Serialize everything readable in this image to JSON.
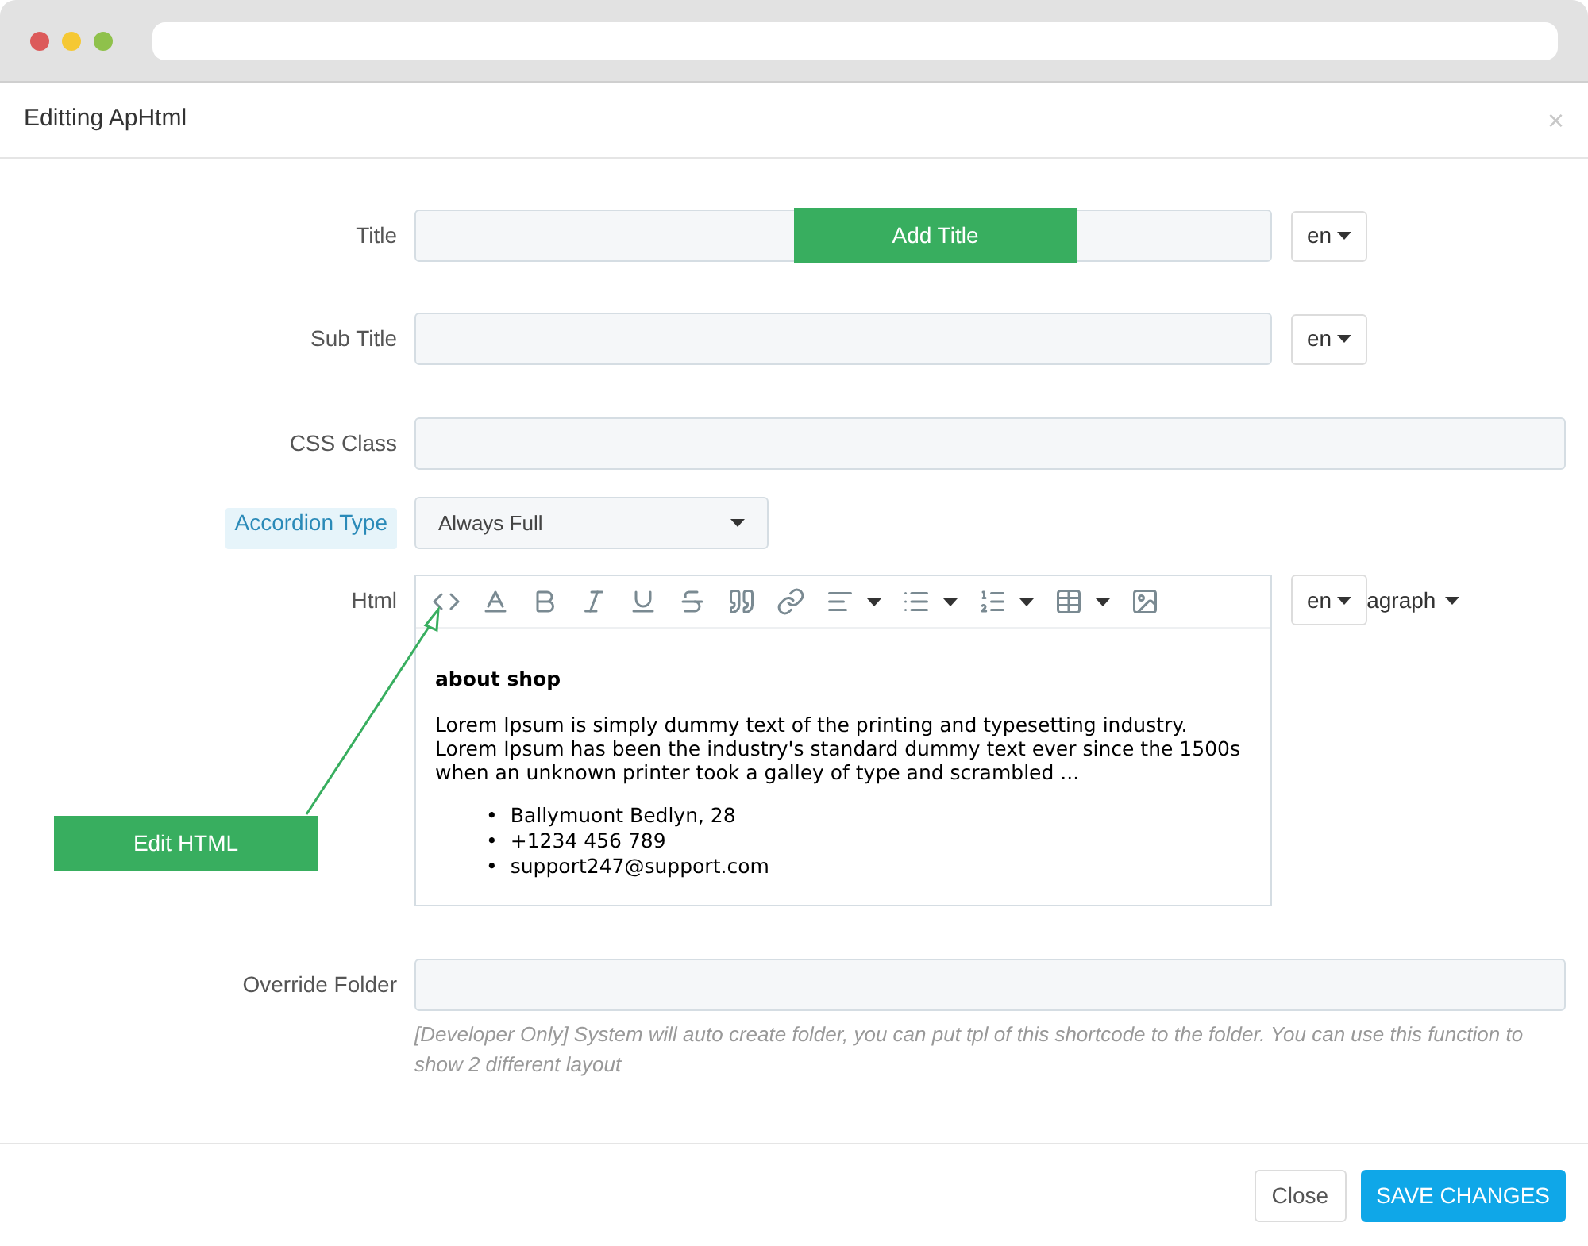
{
  "modal": {
    "title": "Editting ApHtml",
    "close": "×"
  },
  "fields": [
    {
      "kind": "text",
      "label": "Title",
      "lang": "en"
    },
    {
      "kind": "text",
      "label": "Sub Title",
      "lang": "en"
    },
    {
      "kind": "text",
      "label": "CSS Class"
    },
    {
      "kind": "select",
      "label": "Accordion Type",
      "highlighted": true,
      "value": "Always Full"
    },
    {
      "kind": "editor",
      "label": "Html",
      "lang": "en",
      "overflow_text": "agraph",
      "content": {
        "heading": "about shop",
        "paragraph": "Lorem Ipsum is simply dummy text of the printing and typesetting industry. Lorem Ipsum has been the industry's standard dummy text ever since the 1500s when an unknown printer took a galley of type and scrambled ...",
        "list": [
          {
            "marker": "•",
            "text": "Ballymuont Bedlyn, 28"
          },
          {
            "marker": "•",
            "text": "+1234 456 789"
          },
          {
            "marker": "•",
            "text": "support247@support.com"
          }
        ]
      }
    },
    {
      "kind": "text",
      "label": "Override Folder",
      "help": "[Developer Only] System will auto create folder, you can put tpl of this shortcode to the folder. You can use this function to show 2 different layout"
    }
  ],
  "annotations": [
    {
      "kind": "title",
      "text": "Add Title"
    },
    {
      "kind": "html",
      "text": "Edit HTML"
    }
  ],
  "footer": {
    "buttons": [
      {
        "label": "Close",
        "primary": false
      },
      {
        "label": "SAVE CHANGES",
        "primary": true
      }
    ]
  }
}
